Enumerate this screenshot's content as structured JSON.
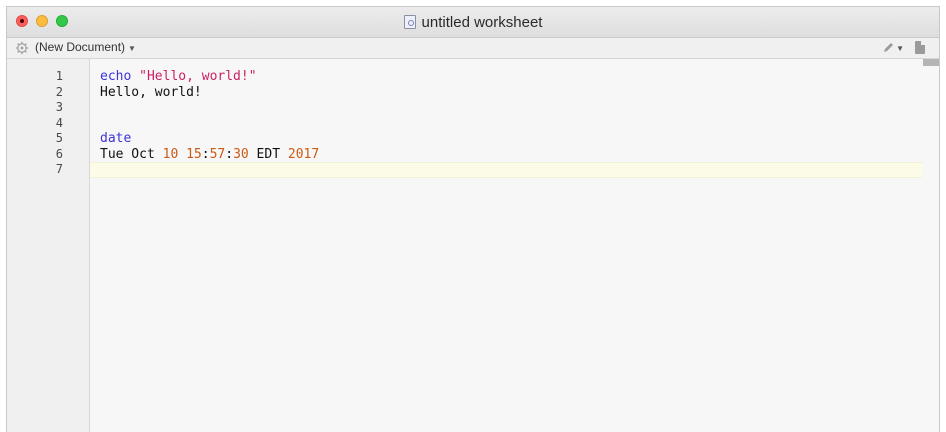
{
  "window": {
    "title": "untitled worksheet"
  },
  "toolbar": {
    "document_menu_label": "(New Document)",
    "icons": [
      "gear-icon",
      "pen-icon",
      "page-icon"
    ]
  },
  "editor": {
    "line_numbers": [
      "1",
      "2",
      "3",
      "4",
      "5",
      "6",
      "7"
    ],
    "lines": [
      {
        "kind": "command",
        "command": "echo",
        "argument": "\"Hello, world!\""
      },
      {
        "kind": "output",
        "text": "Hello, world!"
      },
      {
        "kind": "blank"
      },
      {
        "kind": "blank"
      },
      {
        "kind": "command",
        "command": "date"
      },
      {
        "kind": "output",
        "parts": [
          {
            "t": "Tue Oct ",
            "c": "plain"
          },
          {
            "t": "10",
            "c": "num"
          },
          {
            "t": " ",
            "c": "plain"
          },
          {
            "t": "15",
            "c": "num"
          },
          {
            "t": ":",
            "c": "plain"
          },
          {
            "t": "57",
            "c": "num"
          },
          {
            "t": ":",
            "c": "plain"
          },
          {
            "t": "30",
            "c": "num"
          },
          {
            "t": " EDT ",
            "c": "plain"
          },
          {
            "t": "2017",
            "c": "num"
          }
        ]
      },
      {
        "kind": "current"
      }
    ]
  },
  "colors": {
    "keyword": "#3d33d6",
    "string": "#cc1f64",
    "number": "#cc5a14",
    "current_line": "#fbfbe8"
  }
}
